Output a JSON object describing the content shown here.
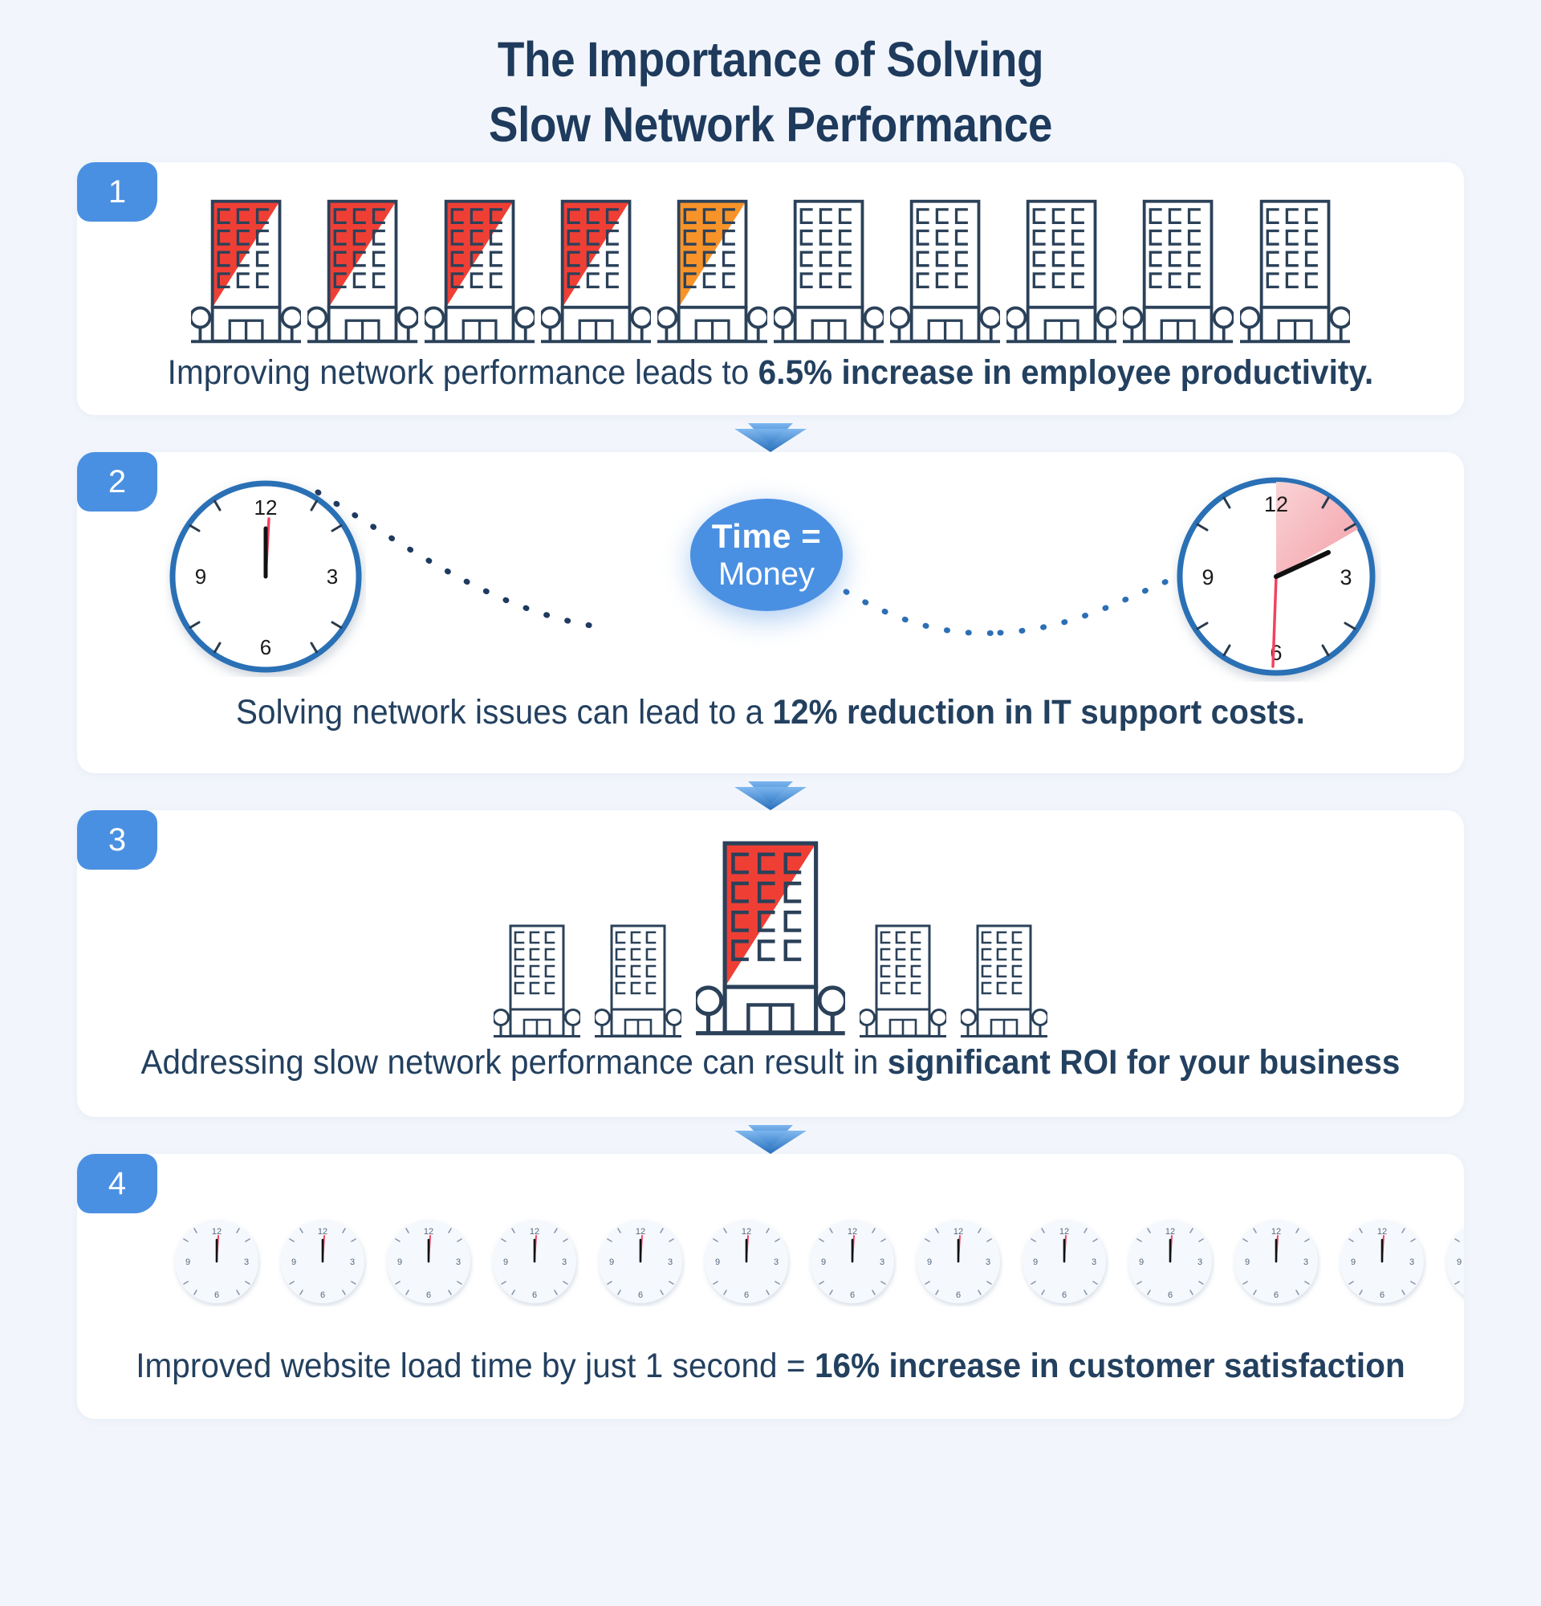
{
  "title": {
    "line1": "The Importance of Solving",
    "line2": "Slow Network Performance"
  },
  "colors": {
    "background": "#f2f6fc",
    "card": "#ffffff",
    "accent_blue": "#4a90e2",
    "navy": "#23405f",
    "title_navy": "#1e3a5c",
    "building_red": "#ef3f35",
    "building_orange": "#f79329",
    "clock_rim": "#2c6fb5",
    "second_hand_red": "#f2435e",
    "outline": "#2b4159"
  },
  "steps": [
    {
      "number": "1",
      "caption_plain": "Improving network performance leads to ",
      "caption_bold": "6.5% increase in employee productivity.",
      "visual": "row-of-ten-buildings",
      "buildings": [
        {
          "fill": "red"
        },
        {
          "fill": "red"
        },
        {
          "fill": "red"
        },
        {
          "fill": "red"
        },
        {
          "fill": "orange"
        },
        {
          "fill": "none"
        },
        {
          "fill": "none"
        },
        {
          "fill": "none"
        },
        {
          "fill": "none"
        },
        {
          "fill": "none"
        }
      ]
    },
    {
      "number": "2",
      "caption_plain": "Solving network issues can lead to a ",
      "caption_bold": "12% reduction in IT support costs.",
      "visual": "two-clocks-with-bubble",
      "bubble": {
        "line1": "Time =",
        "line2": "Money"
      },
      "left_clock": {
        "numerals": [
          "12",
          "3",
          "6",
          "9"
        ],
        "hour_hand": "12",
        "minute_hand": "12",
        "second_hand": "12",
        "highlight_wedge": "none"
      },
      "right_clock": {
        "numerals": [
          "12",
          "3",
          "6",
          "9"
        ],
        "hour_hand": "2",
        "minute_hand": "2",
        "second_hand": "6",
        "highlight_wedge": "12-to-2"
      }
    },
    {
      "number": "3",
      "caption_plain": "Addressing slow network performance can result in ",
      "caption_bold": "significant ROI for your business",
      "visual": "five-buildings-one-tall-red",
      "buildings": [
        {
          "fill": "none",
          "size": "small"
        },
        {
          "fill": "none",
          "size": "small"
        },
        {
          "fill": "red",
          "size": "large"
        },
        {
          "fill": "none",
          "size": "small"
        },
        {
          "fill": "none",
          "size": "small"
        }
      ]
    },
    {
      "number": "4",
      "caption_plain": "Improved website load time by just 1 second = ",
      "caption_bold": "16% increase in customer satisfaction",
      "visual": "row-of-thirteen-small-clocks",
      "clock_count": 13,
      "clock_time": "12:00",
      "last_clock_clipped": true
    }
  ],
  "connector": {
    "icon": "double-chevron-down-icon",
    "count": 3
  }
}
